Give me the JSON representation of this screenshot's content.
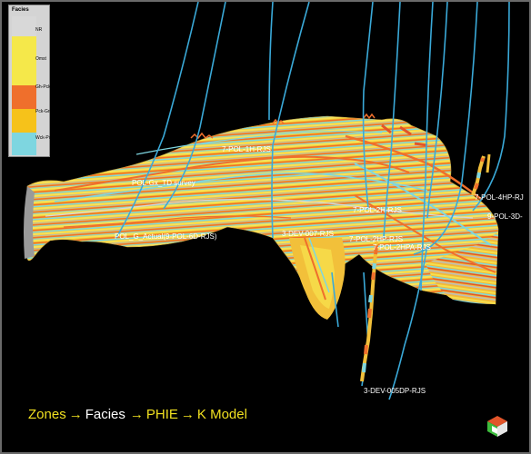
{
  "legend": {
    "title": "Facies",
    "items": [
      {
        "label": "NR",
        "color": "#d8d8d8"
      },
      {
        "label": "Omst",
        "color": "#f5e84a"
      },
      {
        "label": "Gh-Pckst",
        "color": "#ef6f2c"
      },
      {
        "label": "Pck-Grnst",
        "color": "#f6c21a"
      },
      {
        "label": "Wck-Pckst",
        "color": "#7ed6e0"
      }
    ]
  },
  "caption": {
    "zones": "Zones",
    "facies": "Facies",
    "phie": "PHIE",
    "kmodel": "K Model",
    "arrow": "→"
  },
  "wells": [
    {
      "label": "7-POL-1H-RJS"
    },
    {
      "label": "POL-Gx_TD survey"
    },
    {
      "label": "POL_G_Actual(9-POL-6D-RJS)"
    },
    {
      "label": "3-DEV-007-RJS"
    },
    {
      "label": "7-POL-2H-RJS"
    },
    {
      "label": "7-POL-2HP-RJS"
    },
    {
      "label": "7-POL-2HPA-RJS"
    },
    {
      "label": "3-DEV-005DP-RJS"
    },
    {
      "label": "7-POL-4HP-RJ"
    },
    {
      "label": "9-POL-3D-"
    }
  ],
  "colors": {
    "background": "#000000",
    "well_trace": "#3aa9d8",
    "caption_accent": "#f0e020"
  },
  "icons": {
    "orientation": "axis-cube-icon"
  }
}
